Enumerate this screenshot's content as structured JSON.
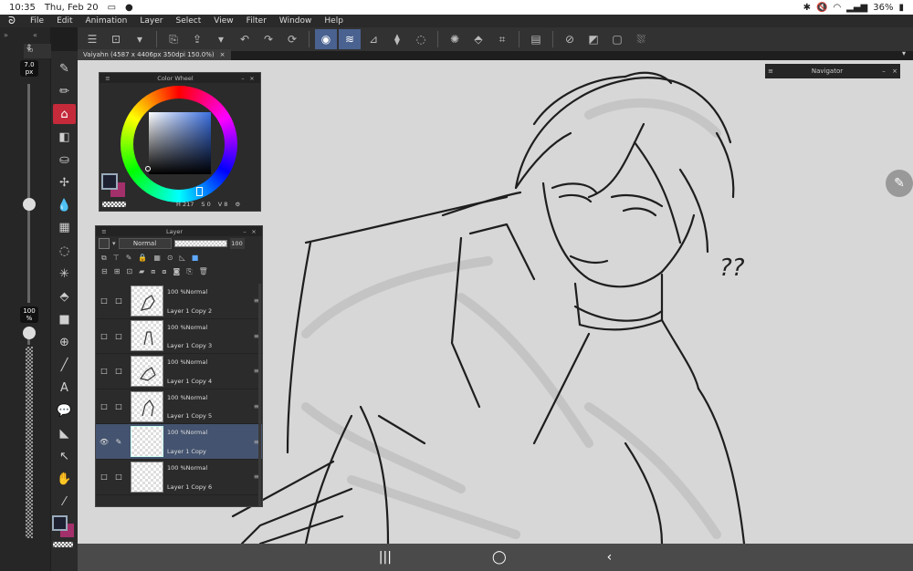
{
  "status": {
    "time": "10:35",
    "date": "Thu, Feb 20",
    "battery": "36%"
  },
  "menu": {
    "items": [
      "File",
      "Edit",
      "Animation",
      "Layer",
      "Select",
      "View",
      "Filter",
      "Window",
      "Help"
    ]
  },
  "canvas": {
    "tab_title": "Vaiyahn (4587 x 4406px 350dpi 150.0%)",
    "tab_close": "×",
    "annotation_text": "??"
  },
  "brush": {
    "size": "7.0",
    "size_unit": "px",
    "opacity": "100",
    "opacity_unit": "%"
  },
  "subtool_tab": {
    "label": "To"
  },
  "navigator": {
    "title": "Navigator"
  },
  "color_wheel": {
    "title": "Color Wheel",
    "main_color": "#1d2030",
    "sub_color": "#a3306a",
    "h": "217",
    "s": "0",
    "v": "8",
    "h_label": "H",
    "s_label": "S",
    "v_label": "V"
  },
  "layer_panel": {
    "title": "Layer",
    "blend_mode": "Normal",
    "opacity": "100",
    "layers": [
      {
        "mode": "100 %Normal",
        "name": "Layer 1 Copy 2",
        "selected": false
      },
      {
        "mode": "100 %Normal",
        "name": "Layer 1 Copy 3",
        "selected": false
      },
      {
        "mode": "100 %Normal",
        "name": "Layer 1 Copy 4",
        "selected": false
      },
      {
        "mode": "100 %Normal",
        "name": "Layer 1 Copy 5",
        "selected": false
      },
      {
        "mode": "100 %Normal",
        "name": "Layer 1 Copy",
        "selected": true
      },
      {
        "mode": "100 %Normal",
        "name": "Layer 1 Copy 6",
        "selected": false
      }
    ]
  },
  "colors": {
    "accent": "#4a6290",
    "selected_layer": "#44536f",
    "active_tool": "#c42a3a"
  }
}
